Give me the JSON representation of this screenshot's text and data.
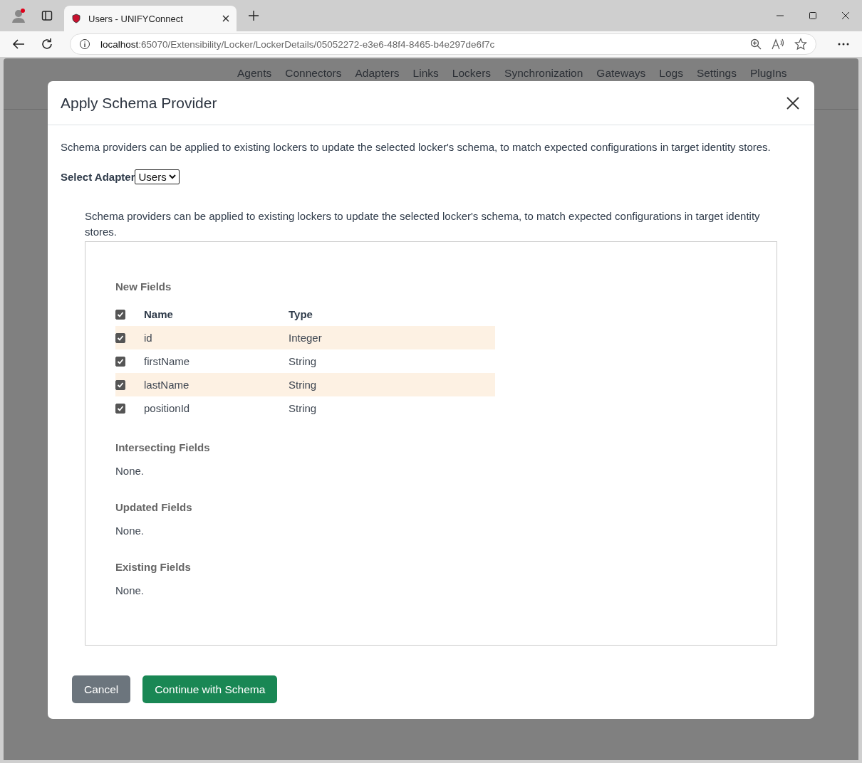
{
  "browser": {
    "tab_title": "Users - UNIFYConnect",
    "url_host": "localhost",
    "url_path": ":65070/Extensibility/Locker/LockerDetails/05052272-e3e6-48f4-8465-b4e297de6f7c"
  },
  "nav": [
    "Agents",
    "Connectors",
    "Adapters",
    "Links",
    "Lockers",
    "Synchronization",
    "Gateways",
    "Logs",
    "Settings",
    "PlugIns"
  ],
  "modal": {
    "title": "Apply Schema Provider",
    "intro": "Schema providers can be applied to existing lockers to update the selected locker's schema, to match expected configurations in target identity stores.",
    "adapter_label": "Select Adapter",
    "adapter_value": "Users",
    "description": "Schema providers can be applied to existing lockers to update the selected locker's schema, to match expected configurations in target identity stores.",
    "sections": [
      {
        "kind": "table",
        "title": "New Fields",
        "select_all_checked": true,
        "columns": [
          "Name",
          "Type"
        ],
        "rows": [
          {
            "name": "id",
            "type": "Integer",
            "checked": true
          },
          {
            "name": "firstName",
            "type": "String",
            "checked": true
          },
          {
            "name": "lastName",
            "type": "String",
            "checked": true
          },
          {
            "name": "positionId",
            "type": "String",
            "checked": true
          }
        ]
      },
      {
        "kind": "empty",
        "title": "Intersecting Fields",
        "text": "None."
      },
      {
        "kind": "empty",
        "title": "Updated Fields",
        "text": "None."
      },
      {
        "kind": "empty",
        "title": "Existing Fields",
        "text": "None."
      }
    ],
    "buttons": [
      {
        "label": "Cancel",
        "kind": "secondary"
      },
      {
        "label": "Continue with Schema",
        "kind": "primary"
      }
    ]
  }
}
